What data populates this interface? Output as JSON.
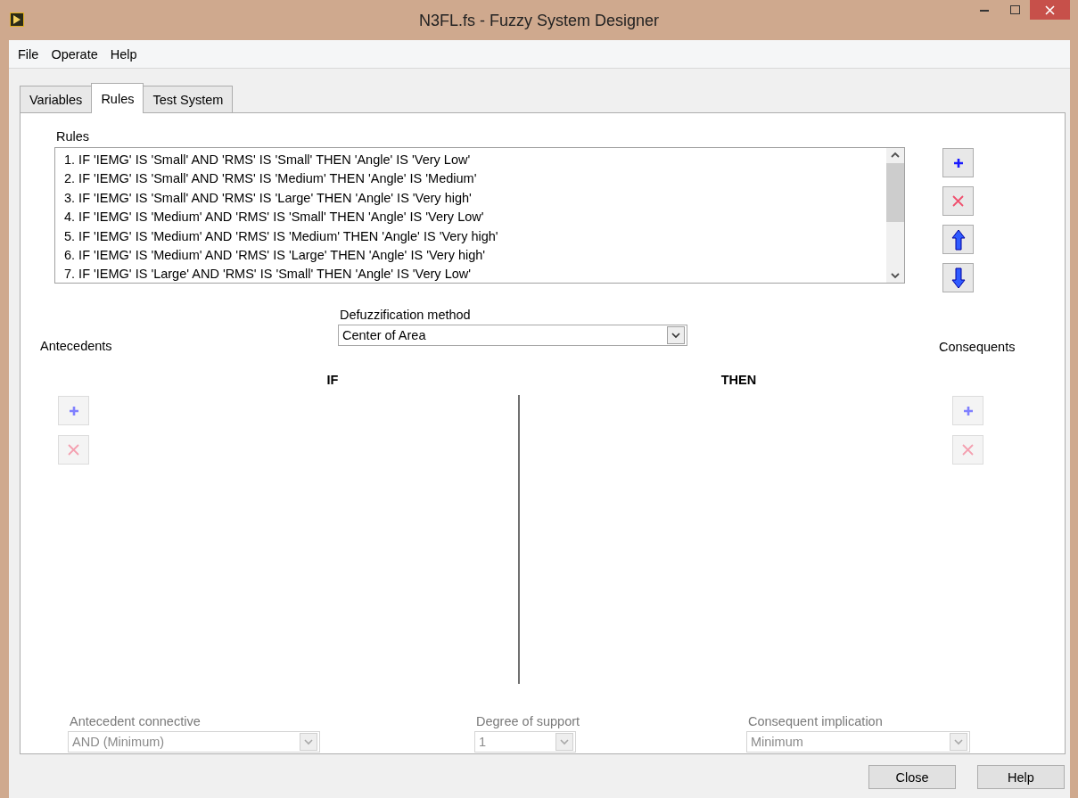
{
  "window": {
    "title": "N3FL.fs - Fuzzy System Designer"
  },
  "menu": [
    "File",
    "Operate",
    "Help"
  ],
  "tabs": [
    {
      "label": "Variables",
      "selected": false
    },
    {
      "label": "Rules",
      "selected": true
    },
    {
      "label": "Test System",
      "selected": false
    }
  ],
  "rules": {
    "label": "Rules",
    "items": [
      "1. IF 'IEMG' IS 'Small' AND 'RMS' IS 'Small' THEN 'Angle' IS 'Very Low'",
      "2. IF 'IEMG' IS 'Small' AND 'RMS' IS 'Medium' THEN 'Angle' IS 'Medium'",
      "3. IF 'IEMG' IS 'Small' AND 'RMS' IS 'Large' THEN 'Angle' IS 'Very high'",
      "4. IF 'IEMG' IS 'Medium' AND 'RMS' IS 'Small' THEN 'Angle' IS 'Very Low'",
      "5. IF 'IEMG' IS 'Medium' AND 'RMS' IS 'Medium' THEN 'Angle' IS 'Very high'",
      "6. IF 'IEMG' IS 'Medium' AND 'RMS' IS 'Large' THEN 'Angle' IS 'Very high'",
      "7. IF 'IEMG' IS 'Large' AND 'RMS' IS 'Small' THEN 'Angle' IS 'Very Low'"
    ],
    "buttons": [
      {
        "kind": "add",
        "disabled": false
      },
      {
        "kind": "delete",
        "disabled": false
      },
      {
        "kind": "up",
        "disabled": false
      },
      {
        "kind": "down",
        "disabled": false
      }
    ]
  },
  "defuzzification": {
    "label": "Defuzzification method",
    "value": "Center of Area",
    "disabled": false
  },
  "antecedents": {
    "label": "Antecedents",
    "header": "IF",
    "buttons": [
      {
        "kind": "add",
        "disabled": true
      },
      {
        "kind": "delete",
        "disabled": true
      }
    ]
  },
  "consequents": {
    "label": "Consequents",
    "header": "THEN",
    "buttons": [
      {
        "kind": "add",
        "disabled": true
      },
      {
        "kind": "delete",
        "disabled": true
      }
    ]
  },
  "antecedent_connective": {
    "label": "Antecedent connective",
    "value": "AND (Minimum)",
    "disabled": true
  },
  "degree_of_support": {
    "label": "Degree of support",
    "value": "1",
    "disabled": true
  },
  "consequent_implication": {
    "label": "Consequent implication",
    "value": "Minimum",
    "disabled": true
  },
  "footer_buttons": [
    "Close",
    "Help"
  ]
}
